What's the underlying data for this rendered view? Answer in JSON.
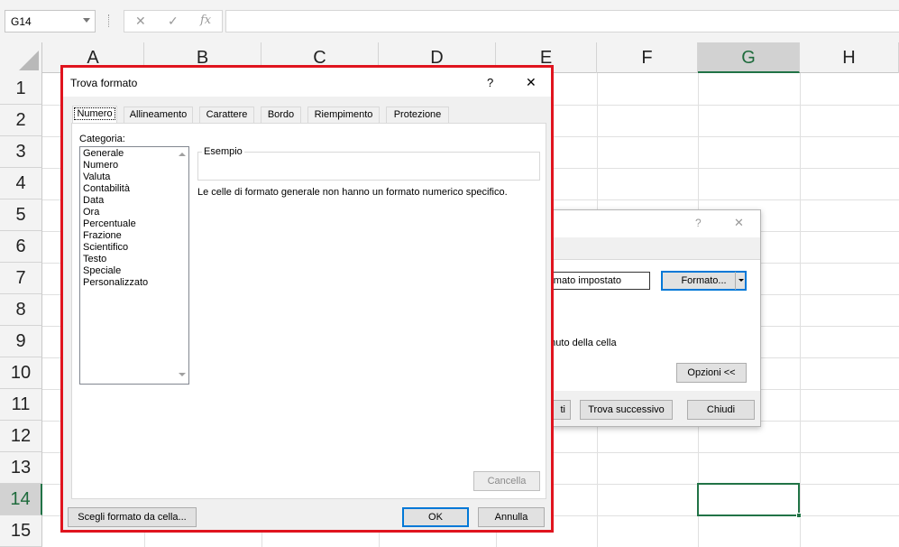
{
  "formula_bar": {
    "name_box": "G14",
    "cancel_glyph": "✕",
    "enter_glyph": "✓",
    "fx_label": "fx",
    "formula": ""
  },
  "grid": {
    "columns": [
      "A",
      "B",
      "C",
      "D",
      "E",
      "F",
      "G",
      "H"
    ],
    "rows": [
      "1",
      "2",
      "3",
      "4",
      "5",
      "6",
      "7",
      "8",
      "9",
      "10",
      "11",
      "12",
      "13",
      "14",
      "15"
    ],
    "selected_column": "G",
    "selected_row": "14",
    "active_cell": "G14"
  },
  "background_dialog": {
    "help": "?",
    "close": "✕",
    "format_field": "ormato impostato",
    "format_button": "Formato...",
    "cell_content_text": "tenuto della cella",
    "options_button": "Opzioni <<",
    "find_all_button": "ti",
    "find_next_button": "Trova successivo",
    "close_button": "Chiudi"
  },
  "dialog": {
    "title": "Trova formato",
    "help": "?",
    "close": "✕",
    "tabs": [
      "Numero",
      "Allineamento",
      "Carattere",
      "Bordo",
      "Riempimento",
      "Protezione"
    ],
    "active_tab": "Numero",
    "category_label": "Categoria:",
    "categories": [
      "Generale",
      "Numero",
      "Valuta",
      "Contabilità",
      "Data",
      "Ora",
      "Percentuale",
      "Frazione",
      "Scientifico",
      "Testo",
      "Speciale",
      "Personalizzato"
    ],
    "sample_label": "Esempio",
    "description": "Le celle di formato generale non hanno un formato numerico specifico.",
    "clear_button": "Cancella",
    "choose_from_cell_button": "Scegli formato da cella...",
    "ok_button": "OK",
    "cancel_button": "Annulla"
  },
  "colors": {
    "highlight_border": "#e0141e",
    "excel_green": "#217346"
  }
}
